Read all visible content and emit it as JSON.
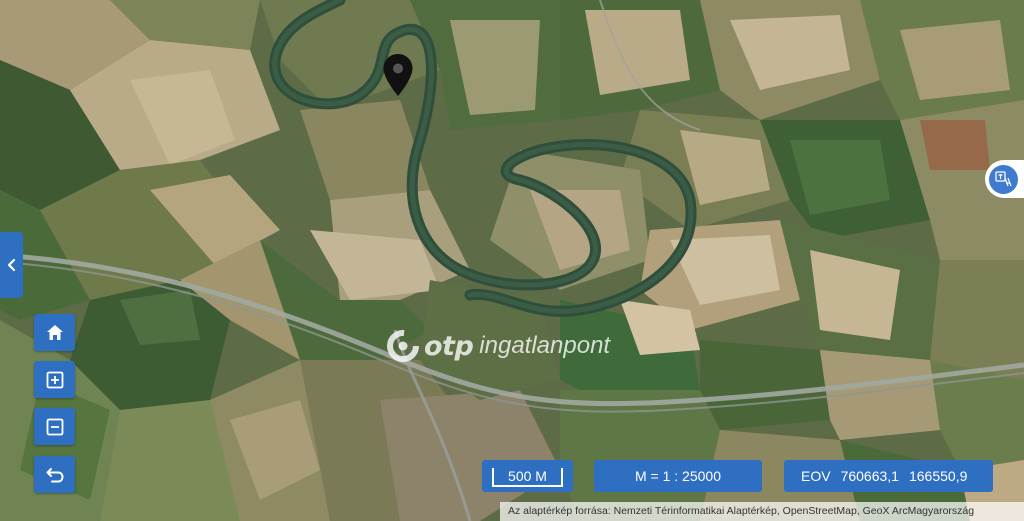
{
  "map": {
    "type": "satellite",
    "marker_icon": "map-pin-icon"
  },
  "watermark": {
    "brand": "otp",
    "product": "ingatlanpont"
  },
  "controls": {
    "home_icon": "home-icon",
    "zoom_in_icon": "plus-square-icon",
    "zoom_out_icon": "minus-square-icon",
    "back_icon": "undo-arrow-icon",
    "sidebar_toggle_icon": "chevron-left-icon",
    "language_icon": "translate-icon"
  },
  "status": {
    "scale_label": "500 M",
    "ratio_label": "M = 1 : 25000",
    "crs_label": "EOV",
    "x_coord": "760663,1",
    "y_coord": "166550,9"
  },
  "attribution": "Az alaptérkép forrása: Nemzeti Térinformatikai Alaptérkép, OpenStreetMap, GeoX ArcMagyarország",
  "colors": {
    "accent": "#2f6fc2",
    "river": "#33543f",
    "road": "#9aa09a"
  }
}
